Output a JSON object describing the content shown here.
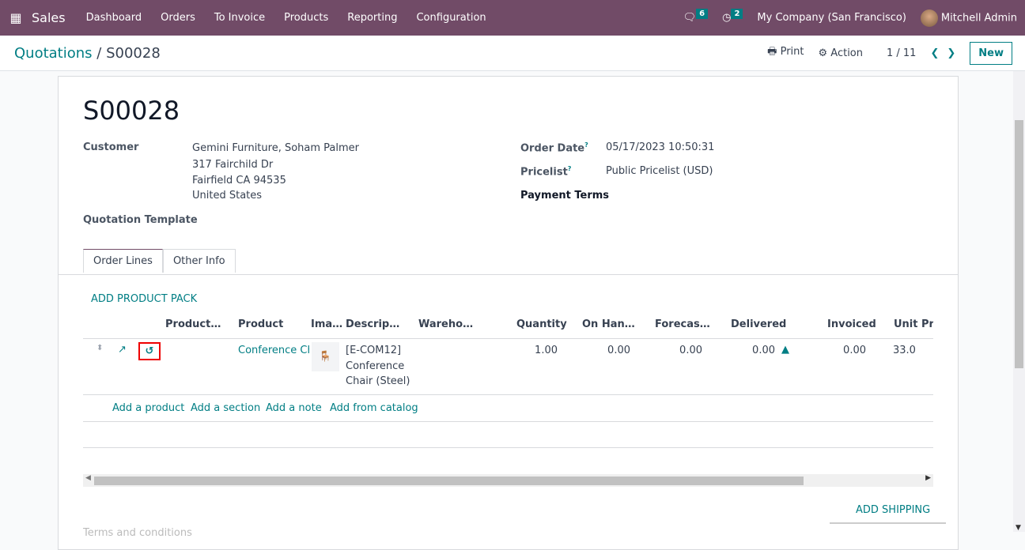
{
  "topbar": {
    "app": "Sales",
    "menus": [
      "Dashboard",
      "Orders",
      "To Invoice",
      "Products",
      "Reporting",
      "Configuration"
    ],
    "messages_count": "6",
    "activities_count": "2",
    "company": "My Company (San Francisco)",
    "user": "Mitchell Admin"
  },
  "control": {
    "breadcrumb_parent": "Quotations",
    "breadcrumb_sep": "/",
    "breadcrumb_current": "S00028",
    "print": "Print",
    "action": "Action",
    "pager": "1 / 11",
    "new": "New"
  },
  "form": {
    "name": "S00028",
    "customer_label": "Customer",
    "customer": "Gemini Furniture, Soham Palmer",
    "address": [
      "317 Fairchild Dr",
      "Fairfield CA 94535",
      "United States"
    ],
    "template_label": "Quotation Template",
    "order_date_label": "Order Date",
    "order_date": "05/17/2023 10:50:31",
    "pricelist_label": "Pricelist",
    "pricelist": "Public Pricelist (USD)",
    "payment_terms_label": "Payment Terms",
    "help": "?"
  },
  "tabs": [
    "Order Lines",
    "Other Info"
  ],
  "lines": {
    "add_pack": "ADD PRODUCT PACK",
    "headers": [
      "Product…",
      "Product",
      "Ima…",
      "Descrip…",
      "Wareho…",
      "Quantity",
      "On Han…",
      "Forecas…",
      "Delivered",
      "Invoiced",
      "Unit Pric"
    ],
    "rows": [
      {
        "product": "Conference Cha",
        "description": [
          "[E-COM12]",
          "Conference",
          "Chair (Steel)"
        ],
        "quantity": "1.00",
        "on_hand": "0.00",
        "forecast": "0.00",
        "delivered": "0.00",
        "invoiced": "0.00",
        "unit_price": "33.0"
      }
    ],
    "add_links": [
      "Add a product",
      "Add a section",
      "Add a note",
      "Add from catalog"
    ]
  },
  "add_shipping": "ADD SHIPPING",
  "terms_placeholder": "Terms and conditions"
}
